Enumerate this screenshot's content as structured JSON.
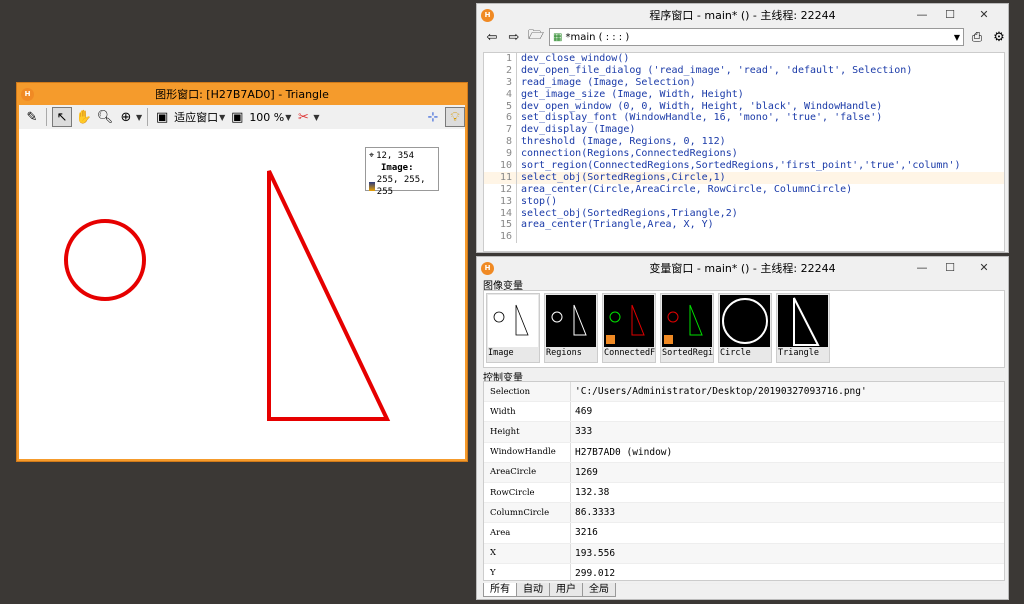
{
  "graphics_window": {
    "title": "图形窗口: [H27B7AD0] - Triangle",
    "toolbar": {
      "fit_label": "适应窗口",
      "zoom_label": "100 %"
    },
    "pixel_info": {
      "coords": "12, 354",
      "channel": "Image:",
      "value": "255, 255, 255"
    }
  },
  "program_window": {
    "title": "程序窗口 - main* () - 主线程: 22244",
    "procedure": "*main ( : : : )",
    "lines": [
      {
        "n": "1",
        "code": "dev_close_window()"
      },
      {
        "n": "2",
        "code": "dev_open_file_dialog ('read_image', 'read', 'default', Selection)"
      },
      {
        "n": "3",
        "code": "read_image (Image, Selection)"
      },
      {
        "n": "4",
        "code": "get_image_size (Image, Width, Height)"
      },
      {
        "n": "5",
        "code": "dev_open_window (0, 0, Width, Height, 'black', WindowHandle)"
      },
      {
        "n": "6",
        "code": "set_display_font (WindowHandle, 16, 'mono', 'true', 'false')"
      },
      {
        "n": "7",
        "code": "dev_display (Image)"
      },
      {
        "n": "8",
        "code": "threshold (Image, Regions, 0, 112)"
      },
      {
        "n": "9",
        "code": "connection(Regions,ConnectedRegions)"
      },
      {
        "n": "10",
        "code": "sort_region(ConnectedRegions,SortedRegions,'first_point','true','column')"
      },
      {
        "n": "11",
        "code": "select_obj(SortedRegions,Circle,1)"
      },
      {
        "n": "12",
        "code": "area_center(Circle,AreaCircle, RowCircle, ColumnCircle)"
      },
      {
        "n": "13",
        "code": "stop()"
      },
      {
        "n": "14",
        "code": "select_obj(SortedRegions,Triangle,2)"
      },
      {
        "n": "15",
        "code": "area_center(Triangle,Area, X, Y)"
      },
      {
        "n": "16",
        "code": ""
      }
    ]
  },
  "variable_window": {
    "title": "变量窗口 - main* () - 主线程: 22244",
    "iconic_label": "图像变量",
    "control_label": "控制变量",
    "thumbnails": [
      "Image",
      "Regions",
      "ConnectedF",
      "SortedRegi",
      "Circle",
      "Triangle"
    ],
    "variables": [
      {
        "name": "Selection",
        "value": "'C:/Users/Administrator/Desktop/20190327093716.png'"
      },
      {
        "name": "Width",
        "value": "469"
      },
      {
        "name": "Height",
        "value": "333"
      },
      {
        "name": "WindowHandle",
        "value": "H27B7AD0 (window)"
      },
      {
        "name": "AreaCircle",
        "value": "1269"
      },
      {
        "name": "RowCircle",
        "value": "132.38"
      },
      {
        "name": "ColumnCircle",
        "value": "86.3333"
      },
      {
        "name": "Area",
        "value": "3216"
      },
      {
        "name": "X",
        "value": "193.556"
      },
      {
        "name": "Y",
        "value": "299.012"
      }
    ],
    "tabs": [
      "所有",
      "自动",
      "用户",
      "全局"
    ]
  }
}
